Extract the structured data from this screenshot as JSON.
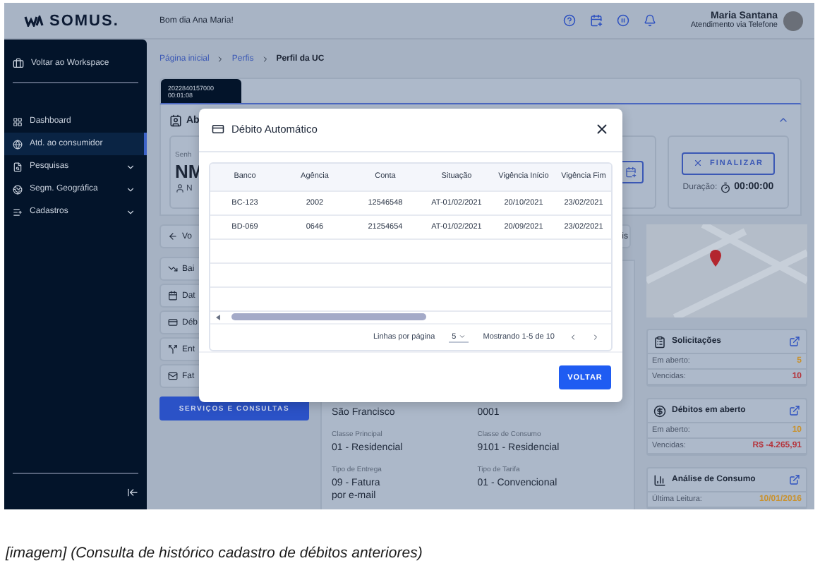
{
  "header": {
    "logo": "SOMUS.",
    "greeting": "Bom dia Ana Maria!",
    "user": {
      "name": "Maria Santana",
      "role": "Atendimento via Telefone"
    }
  },
  "sidebar": {
    "back": "Voltar ao Workspace",
    "items": [
      {
        "label": "Dashboard",
        "selected": false,
        "expandable": false
      },
      {
        "label": "Atd. ao consumidor",
        "selected": true,
        "expandable": false
      },
      {
        "label": "Pesquisas",
        "selected": false,
        "expandable": true
      },
      {
        "label": "Segm. Geográfica",
        "selected": false,
        "expandable": true
      },
      {
        "label": "Cadastros",
        "selected": false,
        "expandable": true
      }
    ]
  },
  "breadcrumb": [
    {
      "label": "Página inicial",
      "current": false
    },
    {
      "label": "Perfis",
      "current": false
    },
    {
      "label": "Perfil da UC",
      "current": true
    }
  ],
  "session_tab": {
    "id": "2022840157000",
    "time": "00:01:08"
  },
  "consumer": {
    "section_title": "Ab",
    "password_label": "Senh",
    "name": "NM",
    "person": "N",
    "finish": "FINALIZAR",
    "duration_label": "Duração:",
    "duration": "00:00:00"
  },
  "menu": {
    "back": "Vo",
    "items": [
      {
        "label": "Bai"
      },
      {
        "label": "Dat"
      },
      {
        "label": "Déb"
      },
      {
        "label": "Ent"
      },
      {
        "label": "Fat"
      }
    ],
    "button": "SERVIÇOS E CONSULTAS"
  },
  "details": {
    "tab": "is",
    "columns": [
      [
        {
          "value": "São Francisco"
        },
        {
          "label": "Classe Principal",
          "value": "01 - Residencial"
        },
        {
          "label": "Tipo de Entrega",
          "value": "09 - Fatura\n por e-mail"
        }
      ],
      [
        {
          "value": "0001"
        },
        {
          "label": "Classe de Consumo",
          "value": "9101 - Residencial"
        },
        {
          "label": "Tipo de Tarifa",
          "value": "01 - Convencional"
        }
      ]
    ]
  },
  "stats": [
    {
      "title": "Solicitações",
      "rows": [
        {
          "label": "Em aberto:",
          "value": "5",
          "color": "#c9922e"
        },
        {
          "label": "Vencidas:",
          "value": "10",
          "color": "#b5343c"
        }
      ]
    },
    {
      "title": "Débitos em aberto",
      "rows": [
        {
          "label": "Em aberto:",
          "value": "10",
          "color": "#c9922e"
        },
        {
          "label": "Vencidas:",
          "value": "R$ -4.265,91",
          "color": "#b5343c"
        }
      ]
    },
    {
      "title": "Análise de Consumo",
      "rows": [
        {
          "label": "Última Leitura:",
          "value": "10/01/2016",
          "color": "#c9922e"
        }
      ]
    }
  ],
  "modal": {
    "title": "Débito Automático",
    "columns": [
      "Banco",
      "Agência",
      "Conta",
      "Situação",
      "Vigência Início",
      "Vigência Fim"
    ],
    "rows": [
      [
        "BC-123",
        "2002",
        "12546548",
        "AT-01/02/2021",
        "20/10/2021",
        "23/02/2021"
      ],
      [
        "BD-069",
        "0646",
        "21254654",
        "AT-01/02/2021",
        "20/09/2021",
        "23/02/2021"
      ]
    ],
    "rows_per_page_label": "Linhas por página",
    "rows_per_page": "5",
    "range": "Mostrando 1-5 de 10",
    "button": "VOLTAR"
  },
  "caption": "[imagem] (Consulta de histórico cadastro de débitos anteriores)"
}
